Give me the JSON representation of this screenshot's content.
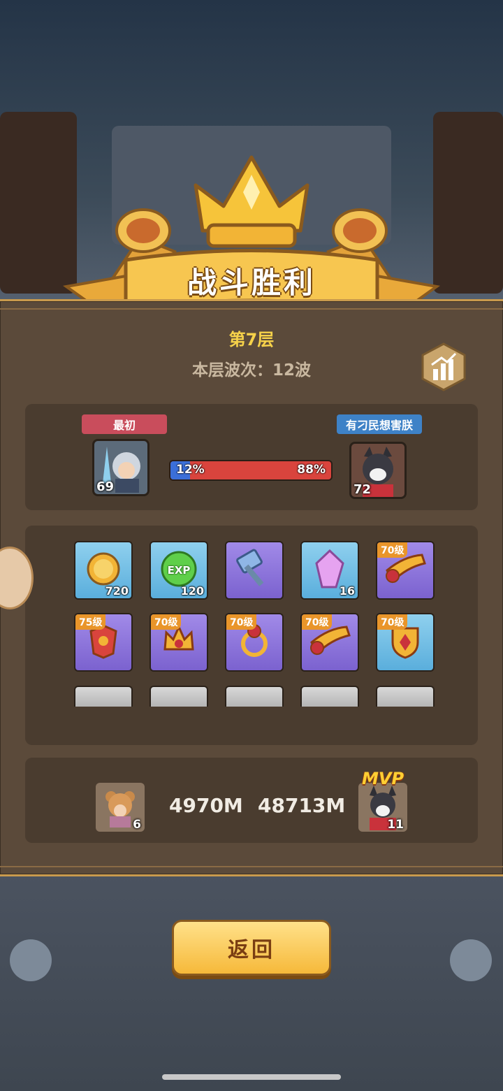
{
  "title": "战斗胜利",
  "floor": "第7层",
  "waves": "本层波次：12波",
  "player_left": {
    "name": "最初",
    "level": "69",
    "name_color": "#c94d5c"
  },
  "player_right": {
    "name": "有刁民想害朕",
    "level": "72",
    "name_color": "#3e82c7"
  },
  "progress": {
    "left_pct_label": "12%",
    "right_pct_label": "88%",
    "left_fraction": 0.12
  },
  "rewards_row1": [
    {
      "icon": "coin-icon",
      "qty": "720",
      "rarity": "blue",
      "badge": ""
    },
    {
      "icon": "exp-icon",
      "qty": "120",
      "rarity": "green",
      "badge": "",
      "label": "EXP"
    },
    {
      "icon": "hammer-icon",
      "qty": "",
      "rarity": "purple",
      "badge": ""
    },
    {
      "icon": "crystal-icon",
      "qty": "16",
      "rarity": "blue",
      "badge": ""
    },
    {
      "icon": "horn-icon",
      "qty": "",
      "rarity": "purple",
      "badge": "70级"
    }
  ],
  "rewards_row2": [
    {
      "icon": "armor-icon",
      "rarity": "purple",
      "badge": "75级"
    },
    {
      "icon": "crown-helmet-icon",
      "rarity": "purple",
      "badge": "70级"
    },
    {
      "icon": "gem-ring-icon",
      "rarity": "purple",
      "badge": "70级"
    },
    {
      "icon": "horn-icon",
      "rarity": "purple",
      "badge": "70级"
    },
    {
      "icon": "shield-icon",
      "rarity": "blue",
      "badge": "70级"
    }
  ],
  "damage": {
    "left_value": "4970M",
    "right_value": "48713M",
    "left_level": "6",
    "right_level": "11",
    "mvp_label": "MVP"
  },
  "return_label": "返回"
}
